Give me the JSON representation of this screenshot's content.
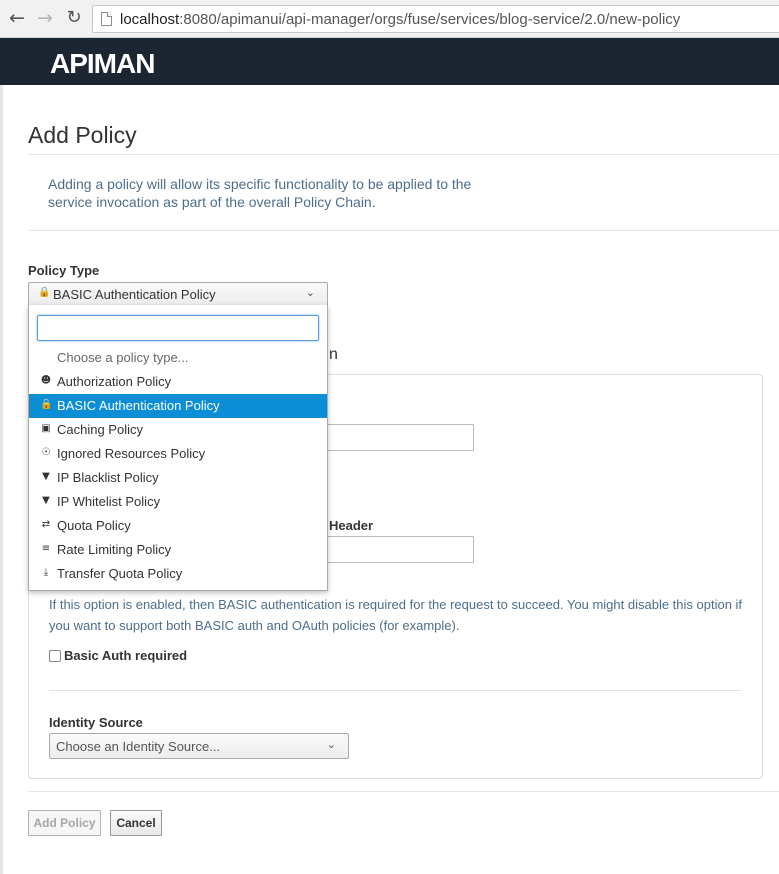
{
  "browser": {
    "url_host": "localhost",
    "url_path": ":8080/apimanui/api-manager/orgs/fuse/services/blog-service/2.0/new-policy"
  },
  "app": {
    "logo": "APIMAN"
  },
  "page": {
    "title": "Add Policy",
    "intro": "Adding a policy will allow its specific functionality to be applied to the service invocation as part of the overall Policy Chain."
  },
  "policy_type": {
    "label": "Policy Type",
    "selected": "BASIC Authentication Policy",
    "search_value": "",
    "options": [
      {
        "label": "Choose a policy type...",
        "icon": ""
      },
      {
        "label": "Authorization Policy",
        "icon": "users-icon"
      },
      {
        "label": "BASIC Authentication Policy",
        "icon": "lock-icon"
      },
      {
        "label": "Caching Policy",
        "icon": "hdd-icon"
      },
      {
        "label": "Ignored Resources Policy",
        "icon": "eye-slash-icon"
      },
      {
        "label": "IP Blacklist Policy",
        "icon": "thumbs-down-icon"
      },
      {
        "label": "IP Whitelist Policy",
        "icon": "filter-icon"
      },
      {
        "label": "Quota Policy",
        "icon": "exchange-icon"
      },
      {
        "label": "Rate Limiting Policy",
        "icon": "sliders-icon"
      },
      {
        "label": "Transfer Quota Policy",
        "icon": "download-icon"
      }
    ]
  },
  "config": {
    "heading_fragment": "n",
    "header_label_fragment": "Header",
    "help_text": "If this option is enabled, then BASIC authentication is required for the request to succeed. You might disable this option if you want to support both BASIC auth and OAuth policies (for example).",
    "checkbox_label": "Basic Auth required",
    "identity_source_label": "Identity Source",
    "identity_source_value": "Choose an Identity Source..."
  },
  "buttons": {
    "add": "Add Policy",
    "cancel": "Cancel"
  },
  "colors": {
    "header_bg": "#1c2532",
    "selected_bg": "#0b8ed6",
    "help_text": "#4d6e8a"
  }
}
